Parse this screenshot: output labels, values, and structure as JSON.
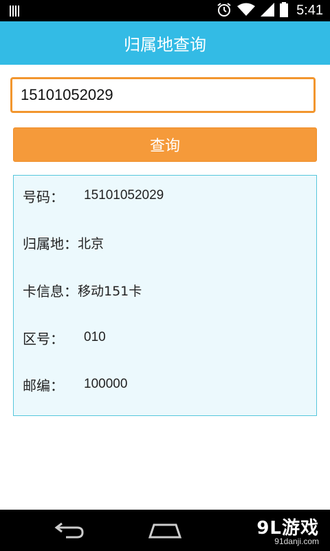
{
  "status_bar": {
    "time": "5:41",
    "icons": [
      "signal-strength-icon",
      "alarm-icon",
      "wifi-icon",
      "cell-signal-icon",
      "battery-icon"
    ]
  },
  "header": {
    "title": "归属地查询"
  },
  "search": {
    "value": "15101052029"
  },
  "query_button": {
    "label": "查询"
  },
  "result": {
    "rows": [
      {
        "label": "号码：",
        "value": "15101052029"
      },
      {
        "label": "归属地：",
        "value": "北京"
      },
      {
        "label": "卡信息：",
        "value": "移动151卡"
      },
      {
        "label": "区号：",
        "value": "010"
      },
      {
        "label": "邮编：",
        "value": "100000"
      }
    ]
  },
  "nav_bar": {
    "icons": [
      "back-icon",
      "home-icon"
    ]
  },
  "watermark": {
    "title": "9L游戏",
    "subtitle": "91danji.com"
  },
  "colors": {
    "title_bar": "#33bbe5",
    "input_border": "#f2962e",
    "button": "#f59a3a",
    "panel_border": "#55c6dc",
    "panel_bg": "#ecf9fd"
  }
}
